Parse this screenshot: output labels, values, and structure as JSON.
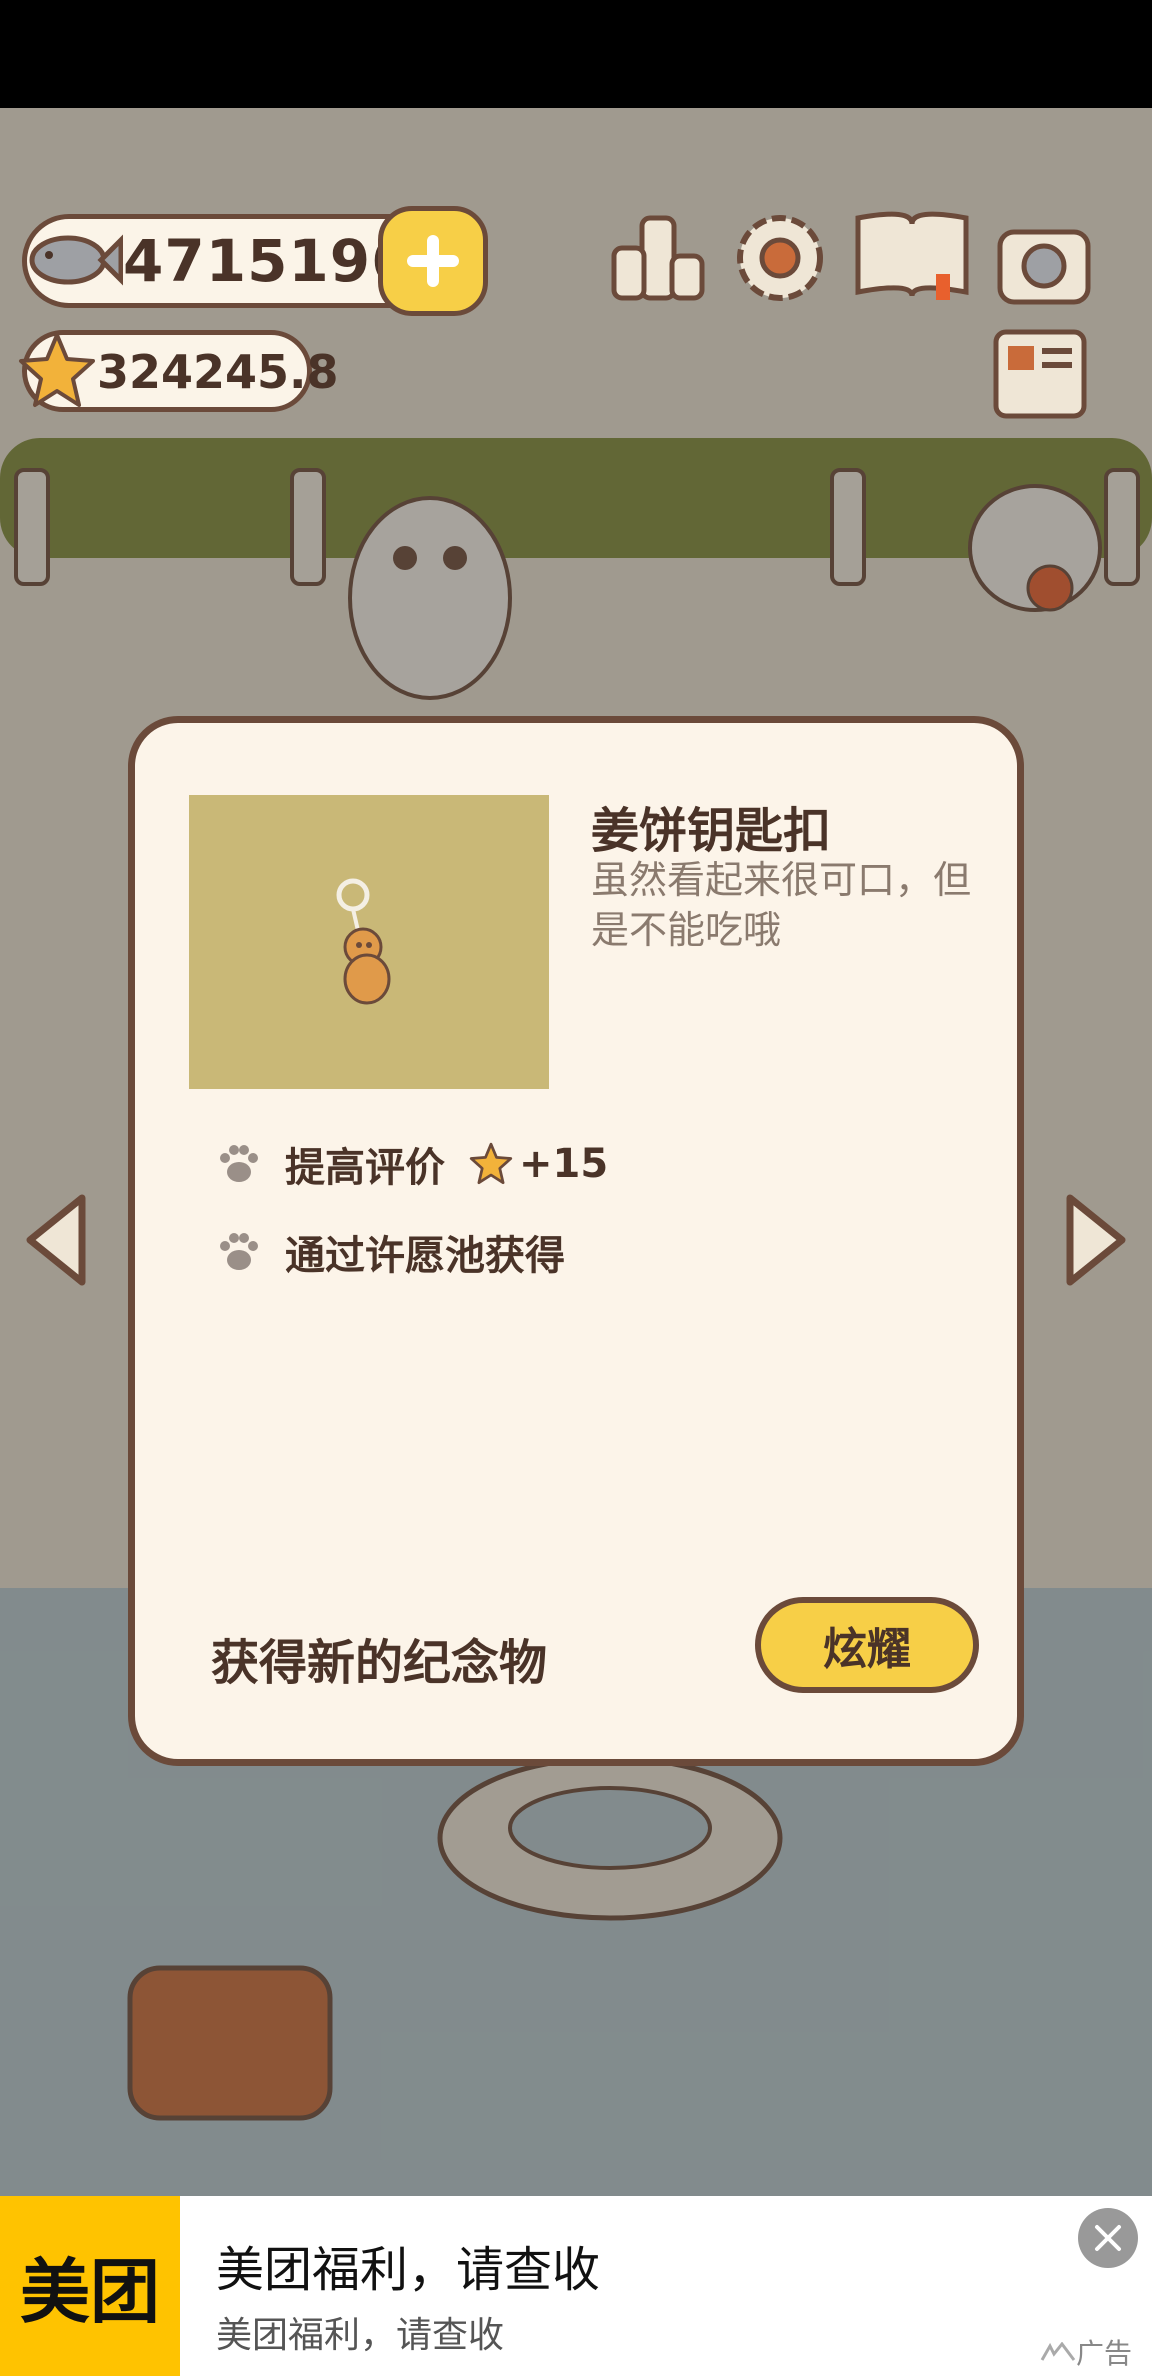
{
  "hud": {
    "fish_count": "4715196",
    "star_rating": "324245.8",
    "plus_icon": "plus-icon",
    "icons": [
      "ranking-podium-icon",
      "settings-gear-icon",
      "cat-book-icon",
      "camera-icon",
      "newspaper-icon"
    ]
  },
  "souvenir_modal": {
    "item_name": "姜饼钥匙扣",
    "item_description": "虽然看起来很可口，但是不能吃哦",
    "item_icon": "gingerbread-keychain-icon",
    "effect_label": "提高评价",
    "effect_value": "+15",
    "source_text": "通过许愿池获得",
    "footer_label": "获得新的纪念物",
    "share_button_label": "炫耀"
  },
  "navigation": {
    "prev_icon": "chevron-left-icon",
    "next_icon": "chevron-right-icon"
  },
  "ad_banner": {
    "logo_text": "美团",
    "title": "美团福利，请查收",
    "subtitle": "美团福利，请查收",
    "tag": "广告"
  },
  "colors": {
    "accent_yellow": "#f7cf47",
    "outline_brown": "#6b4a3a",
    "modal_bg": "#fcf4e9",
    "item_bg": "#c9b877",
    "meituan_yellow": "#ffc300"
  }
}
